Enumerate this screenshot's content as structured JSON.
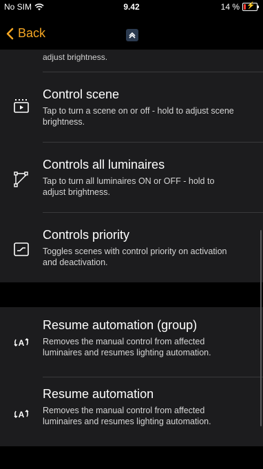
{
  "status_bar": {
    "carrier": "No SIM",
    "time": "9.42",
    "battery": "14 %"
  },
  "nav": {
    "back_label": "Back"
  },
  "top_fragment": "adjust brightness.",
  "items": [
    {
      "title": "Control scene",
      "description": "Tap to turn a scene on or off - hold to adjust scene brightness.",
      "icon": "scene-clapper-icon"
    },
    {
      "title": "Controls all luminaires",
      "description": "Tap to turn all luminaires ON or OFF - hold to adjust brightness.",
      "icon": "luminaires-network-icon"
    },
    {
      "title": "Controls priority",
      "description": "Toggles scenes with control priority on activation and deactivation.",
      "icon": "priority-curve-icon"
    },
    {
      "title": "Resume automation (group)",
      "description": "Removes the manual control from affected luminaires and resumes lighting automation.",
      "icon": "resume-automation-icon"
    },
    {
      "title": "Resume automation",
      "description": "Removes the manual control from affected luminaires and resumes lighting automation.",
      "icon": "resume-automation-icon"
    }
  ],
  "colors": {
    "accent": "#f5a623",
    "background": "#1c1c1e",
    "section_gap": "#000000"
  }
}
